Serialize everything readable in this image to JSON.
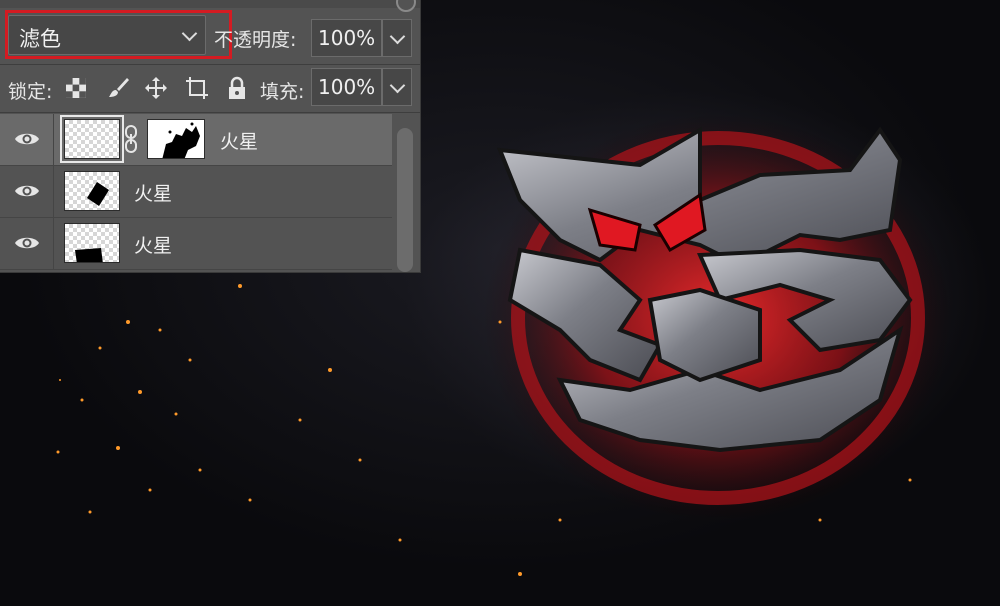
{
  "blend_mode": {
    "value": "滤色"
  },
  "opacity": {
    "label": "不透明度:",
    "value": "100%"
  },
  "lock": {
    "label": "锁定:"
  },
  "fill": {
    "label": "填充:",
    "value": "100%"
  },
  "layers": [
    {
      "name": "火星",
      "visible": true,
      "selected": true,
      "has_mask": true
    },
    {
      "name": "火星",
      "visible": true,
      "selected": false,
      "has_mask": false
    },
    {
      "name": "火星",
      "visible": true,
      "selected": false,
      "has_mask": false
    }
  ],
  "colors": {
    "panel": "#535353",
    "highlight": "#d41b22",
    "selected_row": "#6a6a6a"
  }
}
